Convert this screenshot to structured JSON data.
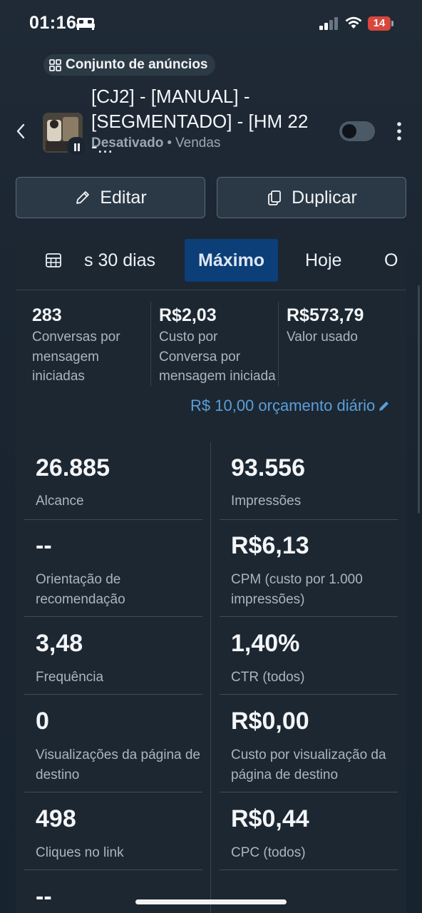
{
  "status_bar": {
    "time": "01:16",
    "battery": "14"
  },
  "header": {
    "chip_label": "Conjunto de anúncios",
    "title": "[CJ2] - [MANUAL] - [SEGMENTADO] - [HM 22 -...",
    "status": "Desativado",
    "objective": "Vendas"
  },
  "actions": {
    "edit_label": "Editar",
    "duplicate_label": "Duplicar"
  },
  "tabs": [
    "s 30 dias",
    "Máximo",
    "Hoje",
    "O"
  ],
  "summary": [
    {
      "value": "283",
      "label": "Conversas por mensagem iniciadas"
    },
    {
      "value": "R$2,03",
      "label": "Custo por Conversa por mensagem iniciada"
    },
    {
      "value": "R$573,79",
      "label": "Valor usado"
    }
  ],
  "budget_text": "R$ 10,00 orçamento diário",
  "metrics_left": [
    {
      "value": "26.885",
      "label": "Alcance"
    },
    {
      "value": "--",
      "label": "Orientação de recomendação"
    },
    {
      "value": "3,48",
      "label": "Frequência"
    },
    {
      "value": "0",
      "label": "Visualizações da página de destino"
    },
    {
      "value": "498",
      "label": "Cliques no link"
    },
    {
      "value": "--",
      "label": ""
    }
  ],
  "metrics_right": [
    {
      "value": "93.556",
      "label": "Impressões"
    },
    {
      "value": "R$6,13",
      "label": "CPM (custo por 1.000 impressões)"
    },
    {
      "value": "1,40%",
      "label": "CTR (todos)"
    },
    {
      "value": "R$0,00",
      "label": "Custo por visualização da página de destino"
    },
    {
      "value": "R$0,44",
      "label": "CPC (todos)"
    }
  ],
  "colors": {
    "accent": "#0c3e77",
    "link": "#5b9fd8",
    "battery": "#d8463c"
  }
}
